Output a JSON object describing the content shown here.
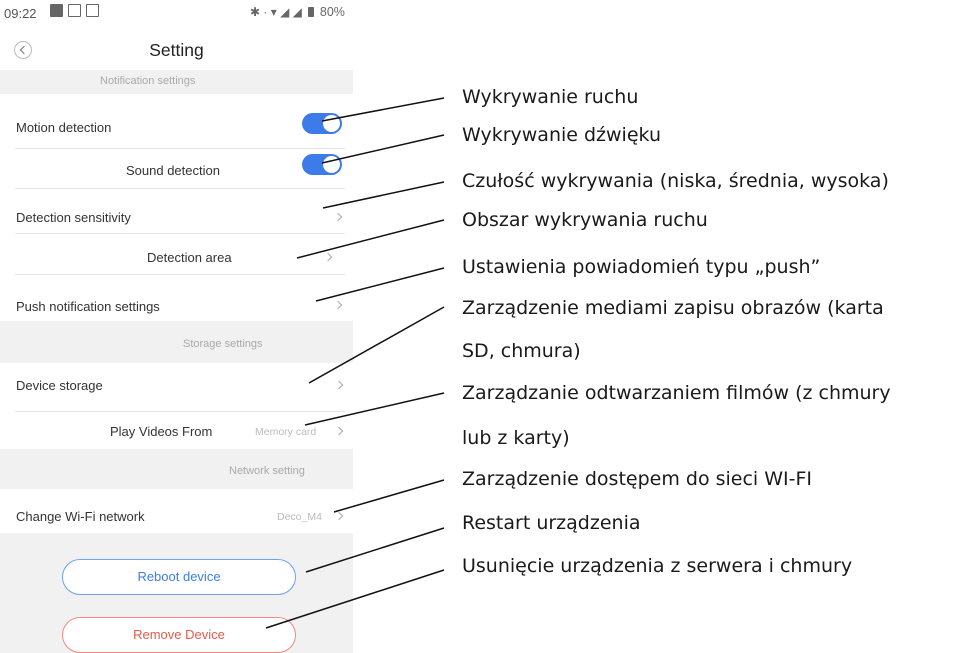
{
  "status_bar": {
    "time": "09:22",
    "icons": [
      "notification-icon",
      "image-icon",
      "mail-icon"
    ],
    "right_glyphs": "✱ · ▾ ◢ ◢",
    "battery": "80%"
  },
  "header": {
    "title": "Setting",
    "back_icon": "chevron-left-icon"
  },
  "sections": {
    "notification": "Notification settings",
    "storage": "Storage settings",
    "network": "Network setting"
  },
  "settings": {
    "motion_detection": {
      "label": "Motion detection",
      "enabled": true
    },
    "sound_detection": {
      "label": "Sound detection",
      "enabled": true
    },
    "detection_sensitivity": {
      "label": "Detection sensitivity"
    },
    "detection_area": {
      "label": "Detection area"
    },
    "push_notification": {
      "label": "Push notification settings"
    },
    "device_storage": {
      "label": "Device storage"
    },
    "play_videos_from": {
      "label": "Play Videos From",
      "value": "Memory card"
    },
    "change_wifi": {
      "label": "Change Wi-Fi network",
      "value": "Deco_M4"
    }
  },
  "buttons": {
    "reboot": "Reboot device",
    "remove": "Remove Device"
  },
  "accent_colors": {
    "toggle": "#3d7ce8",
    "reboot": "#3d7ce8",
    "remove": "#e65a4c"
  },
  "annotations": {
    "motion": "Wykrywanie ruchu",
    "sound": "Wykrywanie dźwięku",
    "sensitivity": "Czułość wykrywania (niska, średnia, wysoka)",
    "area": "Obszar wykrywania ruchu",
    "push": "Ustawienia powiadomień typu „push”",
    "media_line1": "Zarządzenie mediami zapisu obrazów (karta",
    "media_line2": "SD, chmura)",
    "playback_line1": "Zarządzanie odtwarzaniem filmów (z chmury",
    "playback_line2": "lub z karty)",
    "wifi": "Zarządzenie dostępem do sieci WI-FI",
    "restart": "Restart urządzenia",
    "remove": "Usunięcie urządzenia z serwera i chmury"
  }
}
